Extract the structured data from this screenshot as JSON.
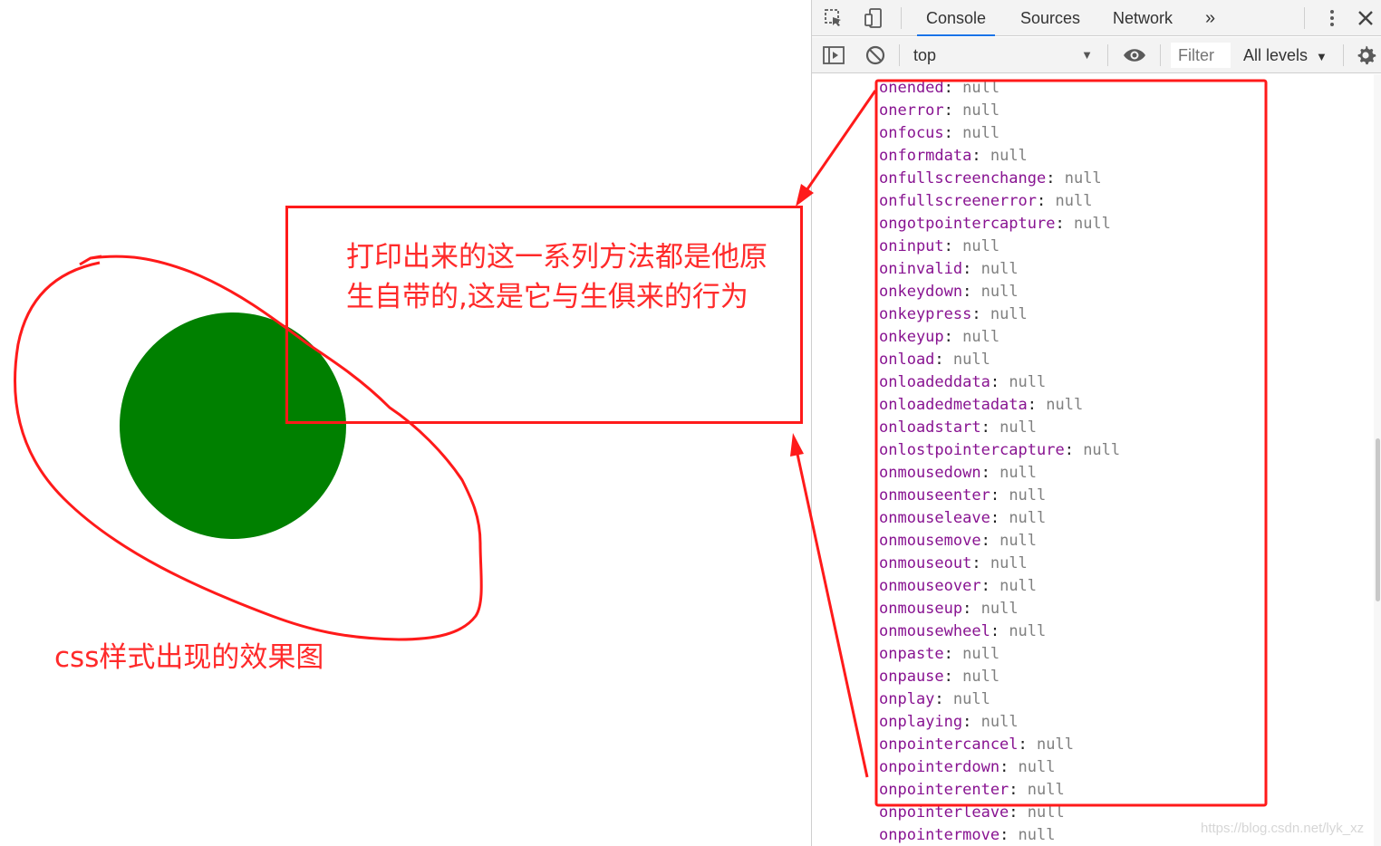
{
  "devtools": {
    "tabs": [
      "Console",
      "Sources",
      "Network"
    ],
    "more_tabs_glyph": "»",
    "context": "top",
    "filter_placeholder": "Filter",
    "levels": "All levels",
    "icons": [
      "inspect-element-icon",
      "device-toolbar-icon",
      "more-tabs-icon",
      "kebab-menu-icon",
      "close-icon",
      "sidebar-toggle-icon",
      "clear-console-icon",
      "eye-icon",
      "settings-gear-icon"
    ]
  },
  "console": {
    "rows": [
      {
        "key": "onended",
        "value": "null"
      },
      {
        "key": "onerror",
        "value": "null"
      },
      {
        "key": "onfocus",
        "value": "null"
      },
      {
        "key": "onformdata",
        "value": "null"
      },
      {
        "key": "onfullscreenchange",
        "value": "null"
      },
      {
        "key": "onfullscreenerror",
        "value": "null"
      },
      {
        "key": "ongotpointercapture",
        "value": "null"
      },
      {
        "key": "oninput",
        "value": "null"
      },
      {
        "key": "oninvalid",
        "value": "null"
      },
      {
        "key": "onkeydown",
        "value": "null"
      },
      {
        "key": "onkeypress",
        "value": "null"
      },
      {
        "key": "onkeyup",
        "value": "null"
      },
      {
        "key": "onload",
        "value": "null"
      },
      {
        "key": "onloadeddata",
        "value": "null"
      },
      {
        "key": "onloadedmetadata",
        "value": "null"
      },
      {
        "key": "onloadstart",
        "value": "null"
      },
      {
        "key": "onlostpointercapture",
        "value": "null"
      },
      {
        "key": "onmousedown",
        "value": "null"
      },
      {
        "key": "onmouseenter",
        "value": "null"
      },
      {
        "key": "onmouseleave",
        "value": "null"
      },
      {
        "key": "onmousemove",
        "value": "null"
      },
      {
        "key": "onmouseout",
        "value": "null"
      },
      {
        "key": "onmouseover",
        "value": "null"
      },
      {
        "key": "onmouseup",
        "value": "null"
      },
      {
        "key": "onmousewheel",
        "value": "null"
      },
      {
        "key": "onpaste",
        "value": "null"
      },
      {
        "key": "onpause",
        "value": "null"
      },
      {
        "key": "onplay",
        "value": "null"
      },
      {
        "key": "onplaying",
        "value": "null"
      },
      {
        "key": "onpointercancel",
        "value": "null"
      },
      {
        "key": "onpointerdown",
        "value": "null"
      },
      {
        "key": "onpointerenter",
        "value": "null"
      },
      {
        "key": "onpointerleave",
        "value": "null"
      },
      {
        "key": "onpointermove",
        "value": "null"
      }
    ]
  },
  "annotations": {
    "callout": "打印出来的这一系列方法都是他原\n生自带的,这是它与生俱来的行为",
    "caption": "css样式出现的效果图",
    "color": "#ff1a1a"
  },
  "page": {
    "circle_color": "#008000"
  },
  "watermark": "https://blog.csdn.net/lyk_xz"
}
